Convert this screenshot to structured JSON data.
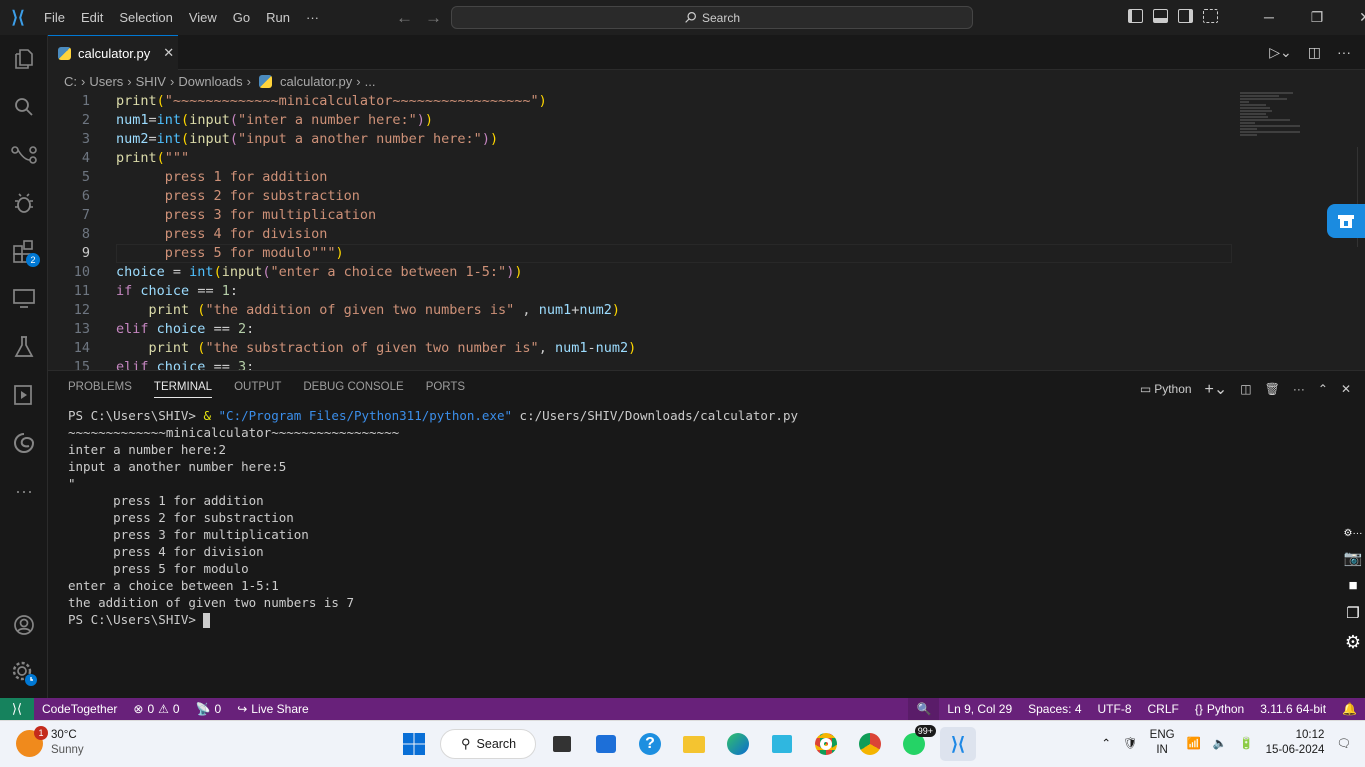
{
  "menu": {
    "items": [
      "File",
      "Edit",
      "Selection",
      "View",
      "Go",
      "Run",
      "···"
    ]
  },
  "search": {
    "label": "Search"
  },
  "tab": {
    "filename": "calculator.py",
    "close": "✕"
  },
  "breadcrumb": [
    "C:",
    "Users",
    "SHIV",
    "Downloads",
    "calculator.py",
    "..."
  ],
  "editor": {
    "active_line": 9,
    "lines": [
      {
        "n": "1",
        "html": "<span class=\"f\">print</span><span class=\"p\">(</span><span class=\"s\">\"~~~~~~~~~~~~~minicalculator~~~~~~~~~~~~~~~~~\"</span><span class=\"p\">)</span>"
      },
      {
        "n": "2",
        "html": "<span class=\"v\">num1</span>=<span class=\"b\">int</span><span class=\"p\">(</span><span class=\"f\">input</span><span class=\"k\">(</span><span class=\"s\">\"inter a number here:\"</span><span class=\"k\">)</span><span class=\"p\">)</span>"
      },
      {
        "n": "3",
        "html": "<span class=\"v\">num2</span>=<span class=\"b\">int</span><span class=\"p\">(</span><span class=\"f\">input</span><span class=\"k\">(</span><span class=\"s\">\"input a another number here:\"</span><span class=\"k\">)</span><span class=\"p\">)</span>"
      },
      {
        "n": "4",
        "html": "<span class=\"f\">print</span><span class=\"p\">(</span><span class=\"s\">\"\"\"</span>"
      },
      {
        "n": "5",
        "html": "<span class=\"s\">      press 1 for addition</span>"
      },
      {
        "n": "6",
        "html": "<span class=\"s\">      press 2 for substraction</span>"
      },
      {
        "n": "7",
        "html": "<span class=\"s\">      press 3 for multiplication</span>"
      },
      {
        "n": "8",
        "html": "<span class=\"s\">      press 4 for division</span>"
      },
      {
        "n": "9",
        "html": "<span class=\"s\">      press 5 for modulo\"\"\"</span><span class=\"p\">)</span>"
      },
      {
        "n": "10",
        "html": "<span class=\"v\">choice</span> = <span class=\"b\">int</span><span class=\"p\">(</span><span class=\"f\">input</span><span class=\"k\">(</span><span class=\"s\">\"enter a choice between 1-5:\"</span><span class=\"k\">)</span><span class=\"p\">)</span>"
      },
      {
        "n": "11",
        "html": "<span class=\"k\">if</span> <span class=\"v\">choice</span> == <span class=\"n\">1</span>:"
      },
      {
        "n": "12",
        "html": "    <span class=\"f\">print</span> <span class=\"p\">(</span><span class=\"s\">\"the addition of given two numbers is\"</span> , <span class=\"v\">num1</span>+<span class=\"v\">num2</span><span class=\"p\">)</span>"
      },
      {
        "n": "13",
        "html": "<span class=\"k\">elif</span> <span class=\"v\">choice</span> == <span class=\"n\">2</span>:"
      },
      {
        "n": "14",
        "html": "    <span class=\"f\">print</span> <span class=\"p\">(</span><span class=\"s\">\"the substraction of given two number is\"</span>, <span class=\"v\">num1</span>-<span class=\"v\">num2</span><span class=\"p\">)</span>"
      },
      {
        "n": "15",
        "html": "<span class=\"k\">elif</span> <span class=\"v\">choice</span> == <span class=\"n\">3</span>:"
      }
    ]
  },
  "panel": {
    "tabs": [
      "PROBLEMS",
      "TERMINAL",
      "OUTPUT",
      "DEBUG CONSOLE",
      "PORTS"
    ],
    "active_tab": "TERMINAL",
    "shell": "Python"
  },
  "terminal": {
    "lines": [
      "PS C:\\Users\\SHIV> & \"C:/Program Files/Python311/python.exe\" c:/Users/SHIV/Downloads/calculator.py",
      "~~~~~~~~~~~~~minicalculator~~~~~~~~~~~~~~~~~",
      "inter a number here:2",
      "input a another number here:5",
      "\"",
      "      press 1 for addition",
      "      press 2 for substraction",
      "      press 3 for multiplication",
      "      press 4 for division",
      "      press 5 for modulo",
      "enter a choice between 1-5:1",
      "the addition of given two numbers is 7",
      "PS C:\\Users\\SHIV> "
    ]
  },
  "status": {
    "codetogether": "CodeTogether",
    "errors": "0",
    "warnings": "0",
    "ports": "0",
    "liveshare": "Live Share",
    "position": "Ln 9, Col 29",
    "spaces": "Spaces: 4",
    "encoding": "UTF-8",
    "eol": "CRLF",
    "language": "Python",
    "interpreter": "3.11.6 64-bit"
  },
  "accent_badge": "2",
  "taskbar": {
    "weather_temp": "30°C",
    "weather_desc": "Sunny",
    "weather_badge": "1",
    "search": "Search",
    "whatsapp_badge": "99+",
    "lang_top": "ENG",
    "lang_bottom": "IN",
    "time": "10:12",
    "date": "15-06-2024"
  },
  "colors": {
    "statusbar": "#68217a",
    "accent": "#0078d4",
    "remote": "#16825d"
  }
}
